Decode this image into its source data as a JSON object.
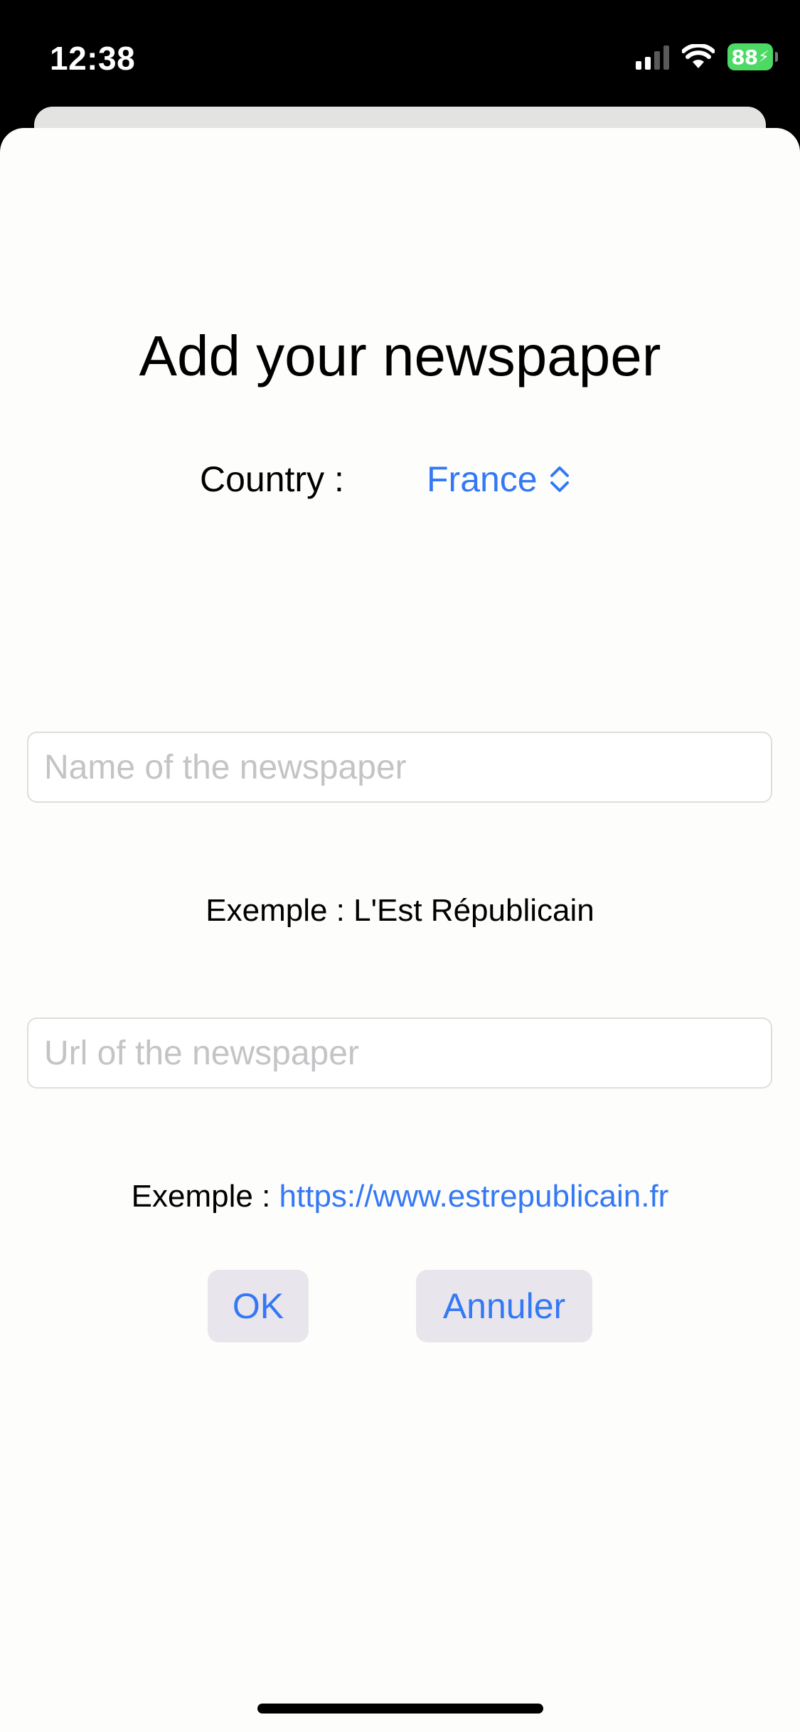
{
  "status_bar": {
    "time": "12:38",
    "battery": "88",
    "icons": [
      "cellular-signal-icon",
      "wifi-icon",
      "battery-charging-icon"
    ]
  },
  "form": {
    "title": "Add your newspaper",
    "country_label": "Country :",
    "country_value": "France",
    "name_placeholder": "Name of the newspaper",
    "name_value": "",
    "name_example_prefix": "Exemple : ",
    "name_example_value": "L'Est Républicain",
    "url_placeholder": "Url of the newspaper",
    "url_value": "",
    "url_example_prefix": "Exemple : ",
    "url_example_link": "https://www.estrepublicain.fr",
    "ok_label": "OK",
    "cancel_label": "Annuler"
  },
  "colors": {
    "accent": "#3478f6",
    "background": "#fdfdfb",
    "button_bg": "#e8e6ec",
    "battery": "#4cd964",
    "placeholder": "#c4c4c7"
  }
}
